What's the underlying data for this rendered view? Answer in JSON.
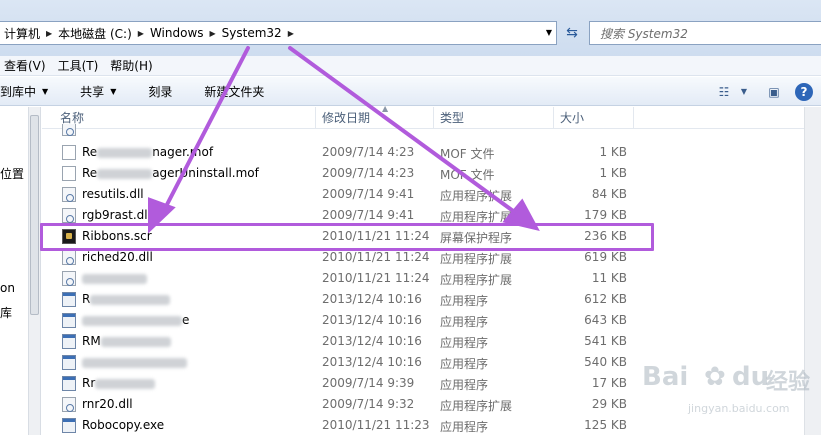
{
  "address": {
    "breadcrumbs": [
      "计算机",
      "本地磁盘 (C:)",
      "Windows",
      "System32"
    ],
    "search_placeholder": "搜索 System32"
  },
  "menu": {
    "items": [
      "查看(V)",
      "工具(T)",
      "帮助(H)"
    ]
  },
  "commands": {
    "library": "到库中",
    "share": "共享",
    "burn": "刻录",
    "new_folder": "新建文件夹"
  },
  "nav": {
    "fragments": [
      "位置",
      "on",
      "库"
    ]
  },
  "columns": {
    "name": "名称",
    "date": "修改日期",
    "type": "类型",
    "size": "大小"
  },
  "files": [
    {
      "name": "Re",
      "name_tail": "nager.mof",
      "date": "2009/7/14 4:23",
      "type": "MOF 文件",
      "size": "1 KB",
      "icon": "file-icon",
      "blur_width": 55
    },
    {
      "name": "Re",
      "name_tail": "agerUninstall.mof",
      "date": "2009/7/14 4:23",
      "type": "MOF 文件",
      "size": "1 KB",
      "icon": "file-icon",
      "blur_width": 55
    },
    {
      "name": "resutils.dll",
      "name_tail": "",
      "date": "2009/7/14 9:41",
      "type": "应用程序扩展",
      "size": "84 KB",
      "icon": "dll-icon",
      "blur_width": 0
    },
    {
      "name": "rgb9rast.dll",
      "name_tail": "",
      "date": "2009/7/14 9:41",
      "type": "应用程序扩展",
      "size": "179 KB",
      "icon": "dll-icon",
      "blur_width": 0
    },
    {
      "name": "Ribbons.scr",
      "name_tail": "",
      "date": "2010/11/21 11:24",
      "type": "屏幕保护程序",
      "size": "236 KB",
      "icon": "screensaver-icon",
      "blur_width": 0
    },
    {
      "name": "riched20.dll",
      "name_tail": "",
      "date": "2010/11/21 11:24",
      "type": "应用程序扩展",
      "size": "619 KB",
      "icon": "dll-icon",
      "blur_width": 0
    },
    {
      "name": "",
      "name_tail": "",
      "date": "2010/11/21 11:24",
      "type": "应用程序扩展",
      "size": "11 KB",
      "icon": "dll-icon",
      "blur_width": 65
    },
    {
      "name": "R",
      "name_tail": "",
      "date": "2013/12/4 10:16",
      "type": "应用程序",
      "size": "612 KB",
      "icon": "exe-icon",
      "blur_width": 80
    },
    {
      "name": "",
      "name_tail": "e",
      "date": "2013/12/4 10:16",
      "type": "应用程序",
      "size": "643 KB",
      "icon": "exe-icon",
      "blur_width": 100
    },
    {
      "name": "RM",
      "name_tail": "",
      "date": "2013/12/4 10:16",
      "type": "应用程序",
      "size": "541 KB",
      "icon": "exe-icon",
      "blur_width": 70
    },
    {
      "name": "",
      "name_tail": "",
      "date": "2013/12/4 10:16",
      "type": "应用程序",
      "size": "540 KB",
      "icon": "exe-icon",
      "blur_width": 105
    },
    {
      "name": "Rr",
      "name_tail": "",
      "date": "2009/7/14 9:39",
      "type": "应用程序",
      "size": "17 KB",
      "icon": "exe-icon",
      "blur_width": 60
    },
    {
      "name": "rnr20.dll",
      "name_tail": "",
      "date": "2009/7/14 9:32",
      "type": "应用程序扩展",
      "size": "29 KB",
      "icon": "dll-icon",
      "blur_width": 0
    },
    {
      "name": "Robocopy.exe",
      "name_tail": "",
      "date": "2010/11/21 11:23",
      "type": "应用程序",
      "size": "125 KB",
      "icon": "exe-icon",
      "blur_width": 0
    }
  ],
  "annotation": {
    "color": "#b15bdc"
  },
  "watermark": {
    "brand_latin": "Bai",
    "brand_latin_2": "du",
    "brand_cn": "经验",
    "url": "jingyan.baidu.com"
  }
}
